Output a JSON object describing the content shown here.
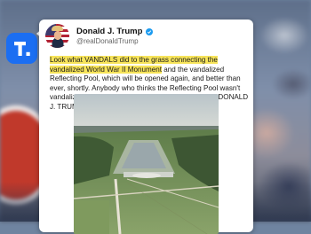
{
  "post": {
    "author_name": "Donald J. Trump",
    "handle": "@realDonaldTrump",
    "text_highlighted": "Look what VANDALS did to the grass connecting the vandalized World War II Monument",
    "text_rest": " and the vandalized Reflecting Pool, which will be opened again, and better than ever, shortly. Anybody who thinks the Reflecting Pool wasn't vandalized should go back to Law School! President DONALD J. TRUMP"
  },
  "colors": {
    "app_icon": "#1b6ef2",
    "highlight": "#f7e45a",
    "verified_badge": "#1d9bf0"
  },
  "icons": {
    "app": "truth-social-logo-icon",
    "verified": "verified-badge-icon",
    "image": "aerial-reflecting-pool-photo"
  }
}
